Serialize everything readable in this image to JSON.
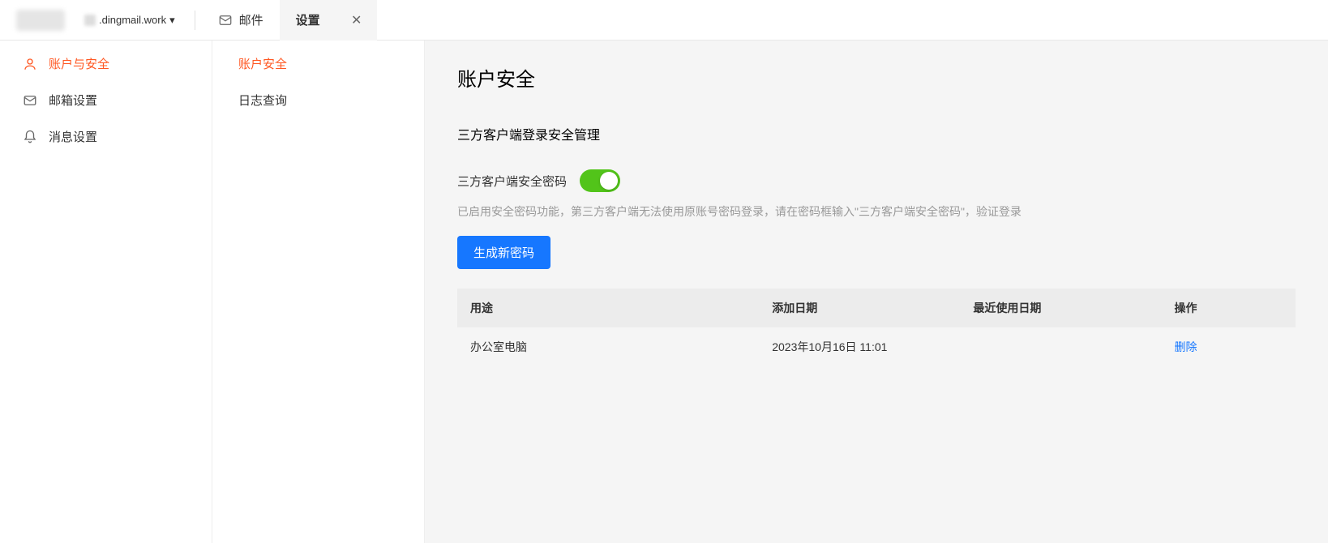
{
  "header": {
    "domain_suffix": ".dingmail.work",
    "tabs": {
      "mail": "邮件",
      "settings": "设置"
    }
  },
  "sidebar": {
    "items": [
      {
        "label": "账户与安全"
      },
      {
        "label": "邮箱设置"
      },
      {
        "label": "消息设置"
      }
    ]
  },
  "subnav": {
    "items": [
      {
        "label": "账户安全"
      },
      {
        "label": "日志查询"
      }
    ]
  },
  "content": {
    "title": "账户安全",
    "section_title": "三方客户端登录安全管理",
    "toggle_label": "三方客户端安全密码",
    "toggle_on": true,
    "hint": "已启用安全密码功能，第三方客户端无法使用原账号密码登录，请在密码框输入\"三方客户端安全密码\"，验证登录",
    "generate_btn": "生成新密码",
    "table": {
      "headers": {
        "purpose": "用途",
        "added": "添加日期",
        "last_used": "最近使用日期",
        "action": "操作"
      },
      "rows": [
        {
          "purpose": "办公室电脑",
          "added": "2023年10月16日 11:01",
          "last_used": "",
          "action": "删除"
        }
      ]
    }
  }
}
